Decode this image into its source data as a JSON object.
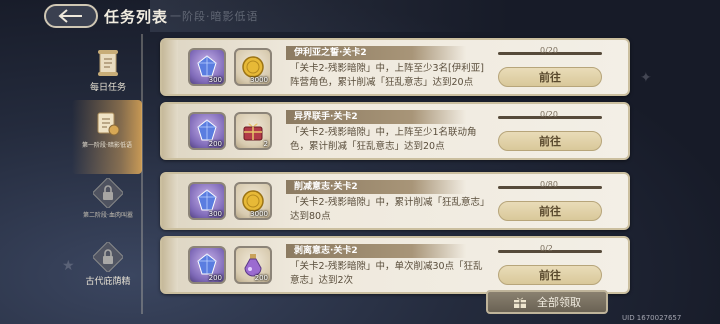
{
  "header": {
    "title": "任务列表",
    "stage_banner": "一阶段·暗影低语"
  },
  "sidebar": {
    "items": [
      {
        "label": "每日任务",
        "icon": "scroll-icon",
        "state": "normal"
      },
      {
        "label": "第一阶段·暗影低语",
        "icon": "quest-scroll-icon",
        "state": "active"
      },
      {
        "label": "第二阶段·血肉叫嚣",
        "icon": "lock-icon",
        "state": "locked"
      },
      {
        "label": "古代庇荫精",
        "icon": "lock-icon",
        "state": "locked"
      }
    ]
  },
  "tasks": [
    {
      "name": "伊利亚之誓·关卡2",
      "description": "「关卡2-残影暗隙」中，上阵至少3名[伊利亚]阵营角色，累计削减「狂乱意志」达到20点",
      "progress": "0/20",
      "progress_fraction": 0,
      "button": "前往",
      "rewards": [
        {
          "type": "purple-crystal",
          "count": "300"
        },
        {
          "type": "gold-coin",
          "count": "3000"
        }
      ]
    },
    {
      "name": "异界联手·关卡2",
      "description": "「关卡2-残影暗隙」中，上阵至少1名联动角色，累计削减「狂乱意志」达到20点",
      "progress": "0/20",
      "progress_fraction": 0,
      "button": "前往",
      "rewards": [
        {
          "type": "purple-crystal",
          "count": "200"
        },
        {
          "type": "gift-pack",
          "count": "2"
        }
      ]
    },
    {
      "name": "削减意志·关卡2",
      "description": "「关卡2-残影暗隙」中，累计削减「狂乱意志」达到80点",
      "progress": "0/80",
      "progress_fraction": 0,
      "button": "前往",
      "rewards": [
        {
          "type": "purple-crystal",
          "count": "300"
        },
        {
          "type": "gold-coin",
          "count": "3000"
        }
      ]
    },
    {
      "name": "剥离意志·关卡2",
      "description": "「关卡2-残影暗隙」中，单次削减30点「狂乱意志」达到2次",
      "progress": "0/2",
      "progress_fraction": 0,
      "button": "前往",
      "rewards": [
        {
          "type": "purple-crystal",
          "count": "200"
        },
        {
          "type": "potion",
          "count": "200"
        }
      ]
    }
  ],
  "footer": {
    "claim_all": "全部领取",
    "uid": "UID 1670027657"
  },
  "colors": {
    "card_bg": "#efe9dd",
    "button_bg": "#e2d3ab",
    "accent_gold": "#d8a855"
  }
}
